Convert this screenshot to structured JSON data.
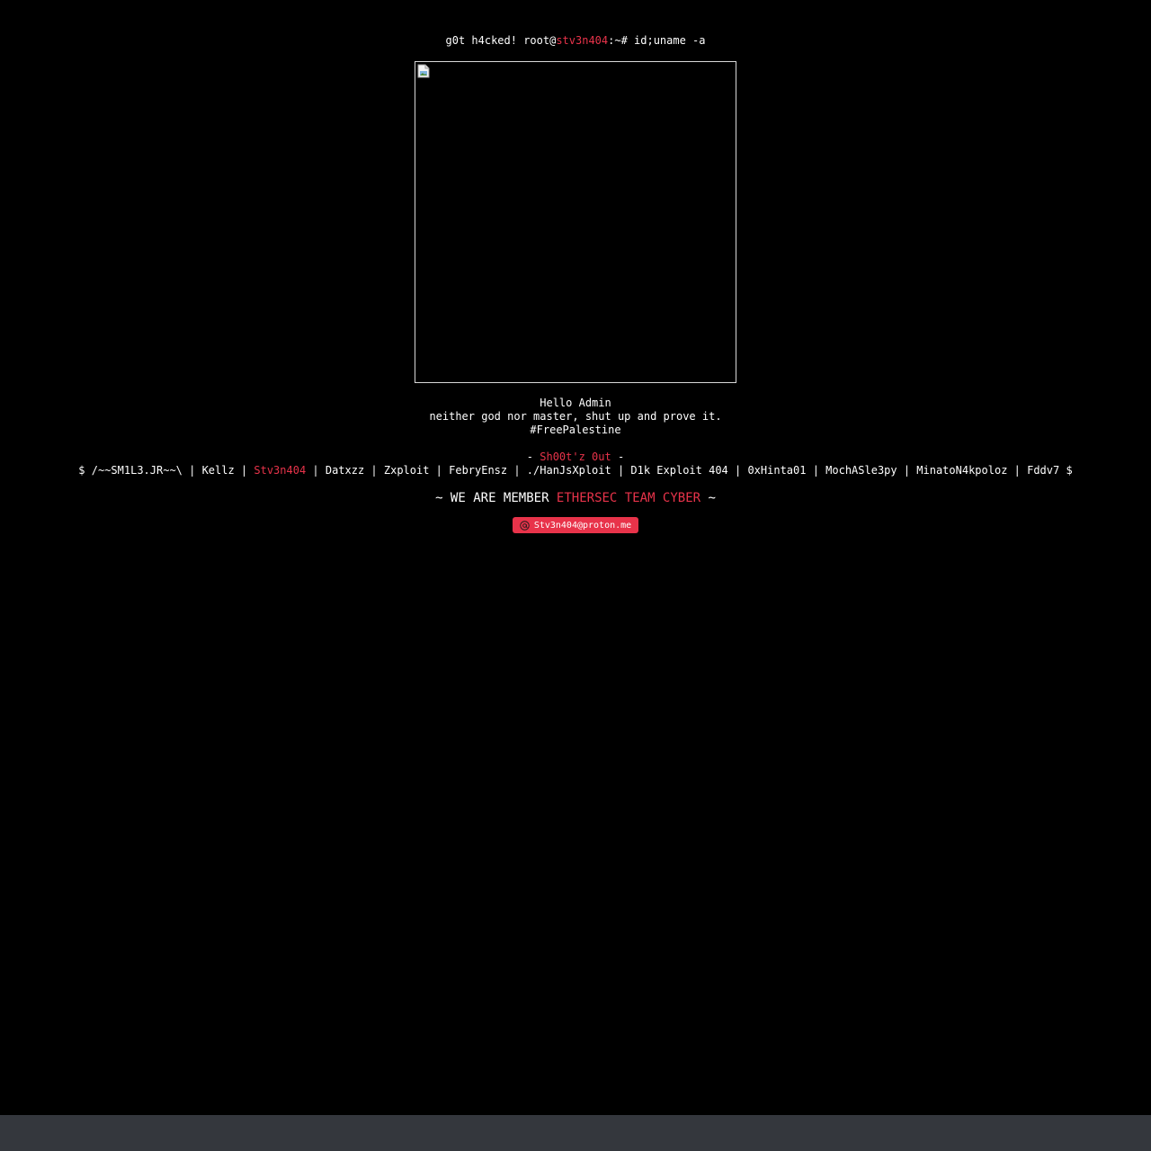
{
  "colors": {
    "background": "#000000",
    "text": "#ffffff",
    "accent": "#e8334a",
    "bottom_bar": "#34373d"
  },
  "prompt": {
    "prefix": "g0t h4cked! root@",
    "host": "stv3n404",
    "suffix": ":~# id;uname -a"
  },
  "image": {
    "icon": "broken-image-icon"
  },
  "message": {
    "greeting": "Hello Admin",
    "motto": "neither god nor master, shut up and prove it.",
    "hashtag": "#FreePalestine"
  },
  "shoutout": {
    "dash_left": "- ",
    "title": "Sh00t'z 0ut",
    "dash_right": " -",
    "names_before": "$ /~~SM1L3.JR~~\\ | Kellz | ",
    "highlighted": "Stv3n404",
    "names_after": " | Datxzz | Zxploit | FebryEnsz | ./HanJsXploit | D1k Exploit 404 | 0xHinta01 | MochASle3py | MinatoN4kpoloz | Fddv7 $"
  },
  "team": {
    "prefix": "~ WE ARE MEMBER ",
    "name": "ETHERSEC TEAM CYBER",
    "suffix": " ~"
  },
  "contact": {
    "icon": "mail-at-icon",
    "email": "Stv3n404@proton.me"
  }
}
